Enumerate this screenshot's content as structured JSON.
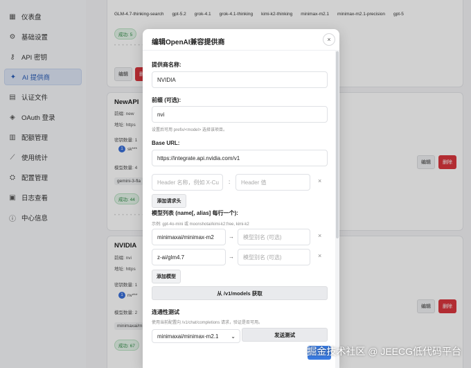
{
  "sidebar": {
    "items": [
      {
        "icon": "dashboard-icon",
        "glyph": "▦",
        "label": "仪表盘"
      },
      {
        "icon": "settings-icon",
        "glyph": "⚙",
        "label": "基础设置"
      },
      {
        "icon": "key-icon",
        "glyph": "⚷",
        "label": "API 密钥"
      },
      {
        "icon": "ai-icon",
        "glyph": "✦",
        "label": "AI 提供商"
      },
      {
        "icon": "file-icon",
        "glyph": "▤",
        "label": "认证文件"
      },
      {
        "icon": "shield-icon",
        "glyph": "◈",
        "label": "OAuth 登录"
      },
      {
        "icon": "quota-icon",
        "glyph": "▥",
        "label": "配额管理"
      },
      {
        "icon": "chart-icon",
        "glyph": "⟋",
        "label": "使用统计"
      },
      {
        "icon": "config-icon",
        "glyph": "⛭",
        "label": "配置管理"
      },
      {
        "icon": "log-icon",
        "glyph": "▣",
        "label": "日志查看"
      },
      {
        "icon": "info-icon",
        "glyph": "ⓘ",
        "label": "中心信息"
      }
    ]
  },
  "background": {
    "top_models": [
      "GLM-4.7-thinking-search",
      "gpt-5.2",
      "grok-4.1",
      "grok-4.1-thinking",
      "kimi-k2-thinking",
      "minimax-m2.1",
      "minimax-m2.1-precision",
      "gpt-5"
    ],
    "success_badge_1": "成功: 5",
    "edit_label": "编辑",
    "delete_label": "删除",
    "newapi": {
      "title": "NewAPI",
      "prefix_label": "前缀: new",
      "url_label": "地址: https",
      "keys_label": "密钥数量: 1",
      "key_index": "1",
      "key_masked": "sk***",
      "models_label": "模型数量: 4",
      "model_chip": "gemini-3-fla",
      "success_badge": "成功: 44"
    },
    "nvidia": {
      "title": "NVIDIA",
      "prefix_label": "前缀: nvi",
      "url_label": "地址: https",
      "keys_label": "密钥数量: 1",
      "key_index": "1",
      "key_masked": "nv***",
      "models_label": "模型数量: 2",
      "model_chip": "minimaxai/mi",
      "success_badge": "成功: 67"
    }
  },
  "modal": {
    "title": "编辑OpenAI兼容提供商",
    "provider_name_label": "提供商名称:",
    "provider_name_value": "NVIDIA",
    "prefix_label": "前缀 (可选):",
    "prefix_value": "nvi",
    "prefix_hint": "设置后可用 prefix/<model> 选择该项目。",
    "base_url_label": "Base URL:",
    "base_url_value": "https://integrate.api.nvidia.com/v1",
    "header_name_placeholder": "Header 名称，例如 X-Cu",
    "header_colon": ":",
    "header_value_placeholder": "Header 值",
    "add_header_label": "添加请求头",
    "models_label": "模型列表 (name[, alias] 每行一个):",
    "models_hint": "示例: gpt-4o-mini 或 moonshotai/kimi-k2:free, kimi-k2",
    "model_rows": [
      {
        "name": "minimaxai/minimax-m2",
        "alias_placeholder": "模型别名 (可选)"
      },
      {
        "name": "z-ai/glm4.7",
        "alias_placeholder": "模型别名 (可选)"
      }
    ],
    "arrow": "→",
    "remove_glyph": "×",
    "add_model_label": "添加模型",
    "fetch_label": "从 /v1/models 获取",
    "conn_test_label": "连通性测试",
    "conn_test_hint": "使用当前配置向 /v1/chat/completions 请求，验证是否可用。",
    "conn_select_value": "minimaxai/minimax-m2.1",
    "send_test_label": "发送测试",
    "close_glyph": "×"
  },
  "watermark": "掘金技术社区 @ JEECG低代码平台",
  "colors": {
    "accent": "#3a7be0",
    "danger": "#d9363e",
    "success": "#2f8a46"
  }
}
